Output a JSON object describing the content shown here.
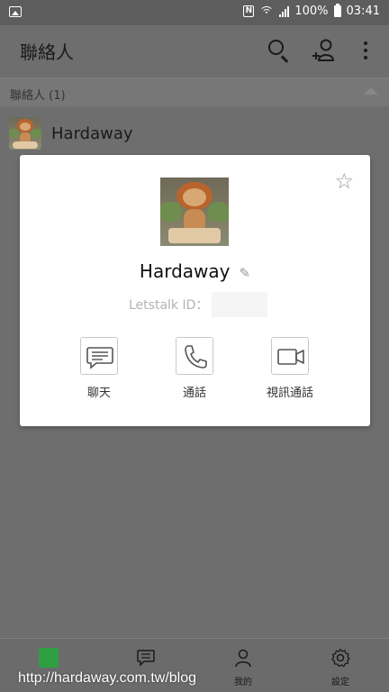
{
  "status_bar": {
    "battery": "100%",
    "time": "03:41",
    "nfc": "N"
  },
  "app_bar": {
    "title": "聯絡人"
  },
  "section": {
    "label": "聯絡人 (1)"
  },
  "contacts": [
    {
      "name": "Hardaway"
    }
  ],
  "card": {
    "name": "Hardaway",
    "id_label": "Letstalk ID：",
    "actions": {
      "chat": "聊天",
      "call": "通話",
      "video": "視訊通話"
    }
  },
  "bottom_nav": {
    "tab_me": "我的",
    "tab_settings": "設定"
  },
  "watermark": "http://hardaway.com.tw/blog",
  "colors": {
    "accent": "#2fa042",
    "overlay": "#6e6e6e",
    "card": "#ffffff"
  }
}
